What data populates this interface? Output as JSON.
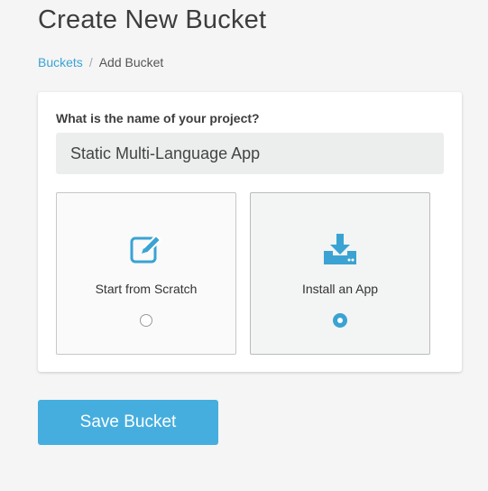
{
  "page": {
    "title": "Create New Bucket"
  },
  "breadcrumb": {
    "items": [
      {
        "label": "Buckets",
        "link": true
      },
      {
        "label": "Add Bucket",
        "link": false
      }
    ],
    "separator": "/"
  },
  "form": {
    "project_question": "What is the name of your project?",
    "project_name_value": "Static Multi-Language App",
    "options": [
      {
        "label": "Start from Scratch",
        "icon": "edit-icon",
        "selected": false
      },
      {
        "label": "Install an App",
        "icon": "download-icon",
        "selected": true
      }
    ]
  },
  "actions": {
    "save_label": "Save Bucket"
  },
  "colors": {
    "accent": "#3aa3d3",
    "button": "#45aede"
  }
}
